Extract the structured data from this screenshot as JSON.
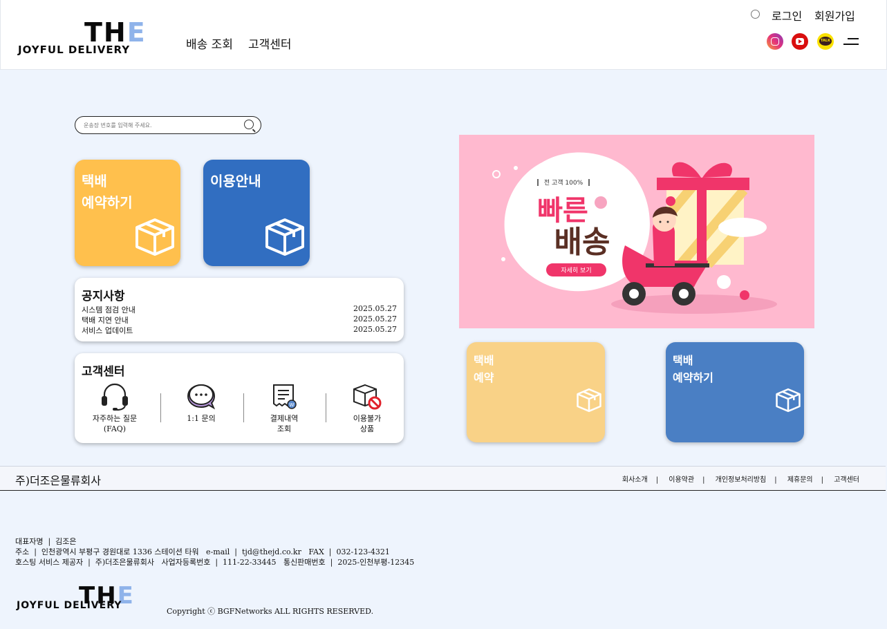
{
  "header": {
    "logo": {
      "main": "THE",
      "sub": "JOYFUL DELIVERY"
    },
    "nav": [
      "배송 조회",
      "고객센터"
    ],
    "login": "로그인",
    "signup": "회원가입",
    "social": [
      "instagram-icon",
      "youtube-icon",
      "kakaotalk-icon"
    ],
    "kakao_text": "TALK"
  },
  "search": {
    "placeholder": "운송장 번호를 입력해 주세요."
  },
  "tiles": {
    "reserve": {
      "label": "택배\n예약하기",
      "color": "#ffc04d"
    },
    "guide": {
      "label": "이용안내",
      "color": "#316ec1"
    },
    "reserve2": {
      "label": "택배\n예약",
      "color": "#f9d287"
    },
    "reserve3": {
      "label": "택배\n예약하기",
      "color": "#4a7fc4"
    }
  },
  "notice": {
    "title": "공지사항",
    "items": [
      {
        "title": "시스템 점검 안내",
        "date": "2025.05.27"
      },
      {
        "title": "택배 지연 안내",
        "date": "2025.05.27"
      },
      {
        "title": "서비스 업데이트",
        "date": "2025.05.27"
      }
    ]
  },
  "customer_center": {
    "title": "고객센터",
    "items": [
      {
        "label": "자주하는 질문\n(FAQ)",
        "icon": "headset-icon"
      },
      {
        "label": "1:1 문의",
        "icon": "chat-bubble-icon"
      },
      {
        "label": "결제내역\n조회",
        "icon": "receipt-icon"
      },
      {
        "label": "이용불가\n상품",
        "icon": "prohibited-box-icon"
      }
    ]
  },
  "banner": {
    "tag": "전 고객 100%",
    "line1": "빠른",
    "line2": "배송",
    "button": "자세히 보기"
  },
  "footer": {
    "company": "주)더조은물류회사",
    "links": [
      "회사소개",
      "이용약관",
      "개인정보처리방침",
      "제휴문의",
      "고객센터"
    ],
    "info": [
      "대표자명  |  김조은",
      "주소  |  인천광역시 부평구 경원대로 1336 스테이션 타워   e-mail  |  tjd@thejd.co.kr   FAX  |  032-123-4321",
      "호스팅 서비스 제공자  |  주)더조은물류회사   사업자등록번호  |  111-22-33445   통신판매번호  |  2025-인천부평-12345"
    ],
    "copyright": "Copyright ⓒ BGFNetworks ALL RIGHTS RESERVED."
  }
}
